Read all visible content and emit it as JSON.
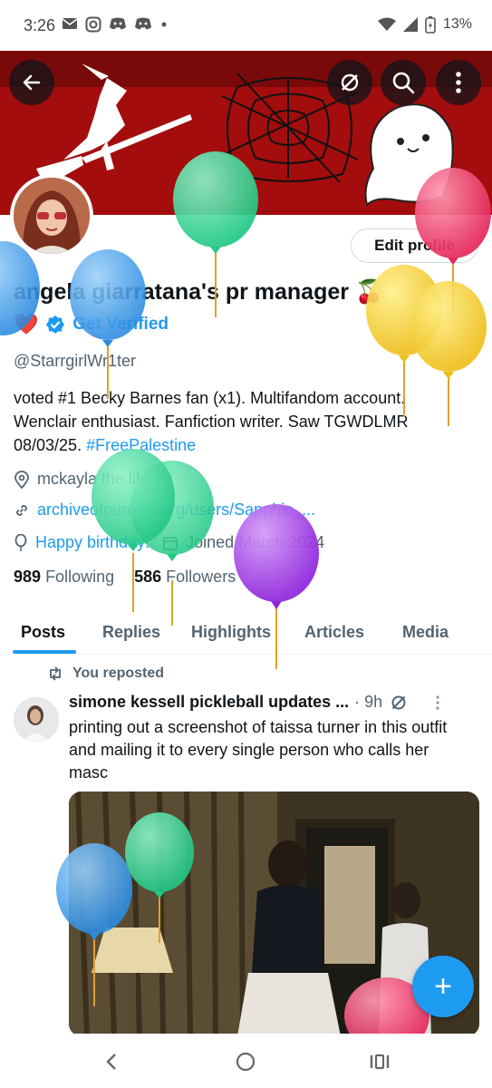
{
  "status_bar": {
    "time": "3:26",
    "battery": "13%",
    "icons": [
      "mail-icon",
      "instagram-icon",
      "discord-icon",
      "discord-icon",
      "dot-icon"
    ]
  },
  "header": {
    "back_icon": "back-arrow-icon",
    "actions": [
      "no-sync-icon",
      "search-icon",
      "more-vertical-icon"
    ]
  },
  "profile": {
    "edit_button": "Edit profile",
    "display_name": "angela giarratana's pr manager 🍒",
    "heart": "❤️",
    "get_verified": "Get Verified",
    "handle": "@StarrgirlWr1ter",
    "bio_text": "voted #1 Becky Barnes fan (x1). Multifandom account. Wenclair enthusiast. Fanfiction writer. Saw TGWDLMR 08/03/25. ",
    "bio_hashtag": "#FreePalestine",
    "location": "mckayla the life 20",
    "website": "archiveofourown.org/users/Sapphic_...",
    "birthday": "Happy birthday!",
    "joined": "Joined March 2024",
    "following_count": "989",
    "following_label": "Following",
    "followers_count": "586",
    "followers_label": "Followers"
  },
  "tabs": [
    {
      "label": "Posts",
      "active": true
    },
    {
      "label": "Replies",
      "active": false
    },
    {
      "label": "Highlights",
      "active": false
    },
    {
      "label": "Articles",
      "active": false
    },
    {
      "label": "Media",
      "active": false
    }
  ],
  "feed": {
    "repost_label": "You reposted",
    "tweet": {
      "author": "simone kessell pickleball updates ...",
      "time": "· 9h",
      "text": "printing out a screenshot of taissa turner in this outfit and mailing it to every single person who calls her masc"
    }
  },
  "fab_label": "+",
  "colors": {
    "accent": "#1d9bf0",
    "banner": "#a30d0d",
    "balloon_green": "#3fd99a",
    "balloon_blue": "#4aa3ea",
    "balloon_yellow": "#f5cd2f",
    "balloon_pink": "#ec4a72",
    "balloon_purple": "#a13ee8"
  }
}
